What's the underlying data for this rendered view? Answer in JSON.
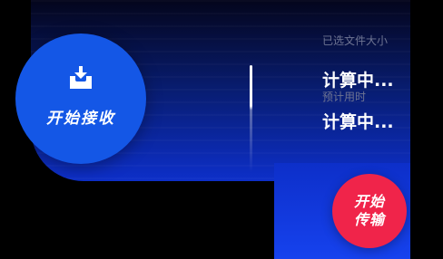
{
  "receive_button": {
    "label": "开始接收",
    "icon": "download-tray-icon"
  },
  "stats": {
    "size_label": "已选文件大小",
    "size_value": "计算中...",
    "time_label": "预计用时",
    "time_value": "计算中..."
  },
  "transfer_button": {
    "label": "开始传输"
  },
  "colors": {
    "background": "#000000",
    "panel_gradient_top": "#04051c",
    "panel_gradient_bottom": "#1642ee",
    "receive_button": "#1457e6",
    "transfer_button": "#f0244a",
    "label_gray": "#6f7593",
    "text_white": "#ffffff"
  }
}
